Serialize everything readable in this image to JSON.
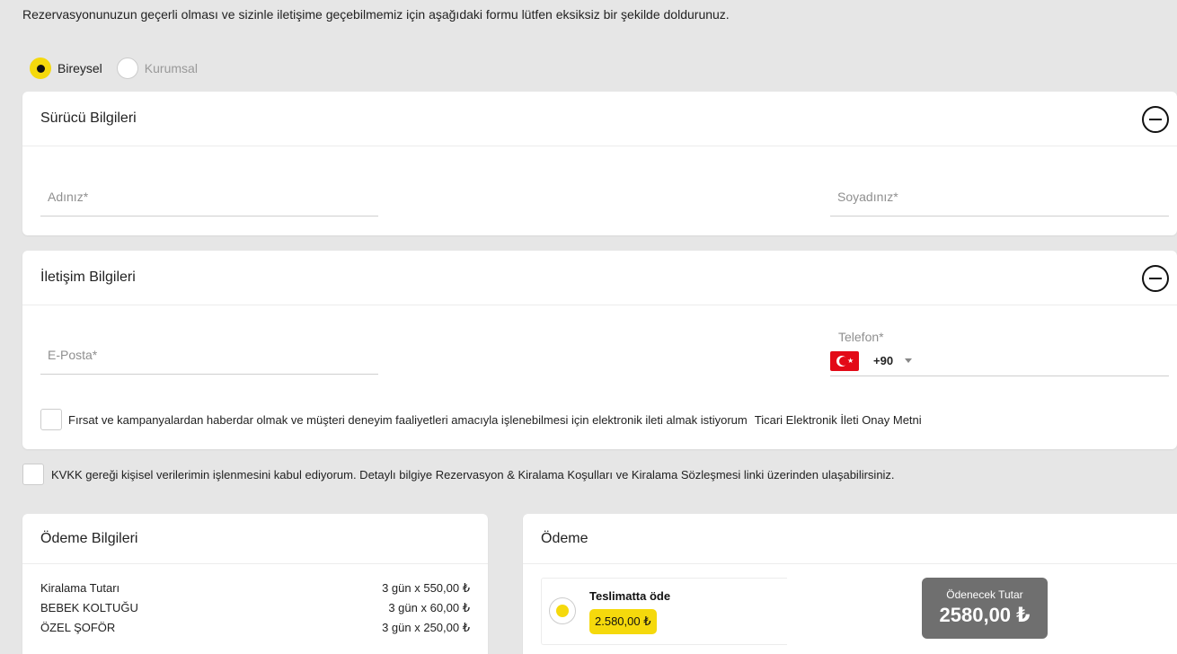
{
  "intro_text": "Rezervasyonunuzun geçerli olması ve sizinle iletişime geçebilmemiz için aşağıdaki formu lütfen eksiksiz bir şekilde doldurunuz.",
  "customer_type": {
    "options": [
      {
        "label": "Bireysel",
        "selected": true
      },
      {
        "label": "Kurumsal",
        "selected": false
      }
    ]
  },
  "driver": {
    "title": "Sürücü Bilgileri",
    "first_name_placeholder": "Adınız*",
    "last_name_placeholder": "Soyadınız*"
  },
  "contact": {
    "title": "İletişim Bilgileri",
    "email_placeholder": "E-Posta*",
    "phone_label": "Telefon*",
    "dial_code": "+90",
    "marketing_consent": "Fırsat ve kampanyalardan haberdar olmak ve müşteri deneyim faaliyetleri amacıyla işlenebilmesi için elektronik ileti almak istiyorum",
    "marketing_link": "Ticari Elektronik İleti Onay Metni"
  },
  "kvkk_consent": "KVKK gereği kişisel verilerimin işlenmesini kabul ediyorum. Detaylı bilgiye Rezervasyon & Kiralama Koşulları ve Kiralama Sözleşmesi linki üzerinden ulaşabilirsiniz.",
  "payment_info": {
    "title": "Ödeme Bilgileri",
    "rows": [
      {
        "label": "Kiralama Tutarı",
        "value": "3 gün x 550,00 ₺"
      },
      {
        "label": "BEBEK KOLTUĞU",
        "value": "3 gün x 60,00 ₺"
      },
      {
        "label": "ÖZEL ŞOFÖR",
        "value": "3 gün x 250,00 ₺"
      }
    ]
  },
  "payment": {
    "title": "Ödeme",
    "option_title": "Teslimatta öde",
    "option_amount": "2.580,00 ₺",
    "total_label": "Ödenecek Tutar",
    "total_value": "2580,00 ₺"
  },
  "colors": {
    "accent": "#f5d90c",
    "background": "#e6e6e6",
    "total_box": "#6f6f6f"
  },
  "icons": {
    "collapse": "minus-circle-icon",
    "flag": "turkey-flag-icon",
    "dropdown": "caret-down-icon"
  }
}
